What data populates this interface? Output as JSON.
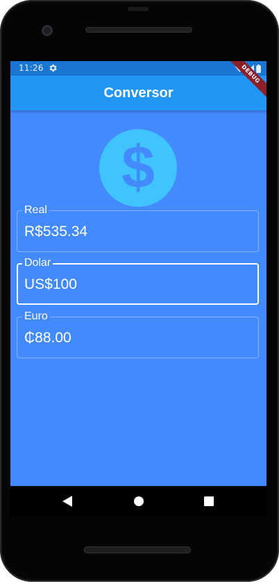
{
  "status_bar": {
    "time": "11:26",
    "icons": [
      "settings-gear-icon",
      "wifi-icon",
      "signal-icon",
      "battery-icon"
    ]
  },
  "debug_banner": "DEBUG",
  "app_bar": {
    "title": "Conversor",
    "color": "#2196f3"
  },
  "hero_icon": "monetization-on-icon",
  "fields": [
    {
      "label": "Real",
      "value": "R$535.34",
      "focused": false
    },
    {
      "label": "Dolar",
      "value": "US$100",
      "focused": true
    },
    {
      "label": "Euro",
      "value": "₵88.00",
      "focused": false
    }
  ],
  "nav_bar": {
    "buttons": [
      "back-icon",
      "home-icon",
      "recents-icon"
    ]
  },
  "colors": {
    "background": "#448aff",
    "status_bar": "#1976d2",
    "icon": "#40c4ff",
    "icon_glyph": "#448aff",
    "text": "#ffffff"
  }
}
